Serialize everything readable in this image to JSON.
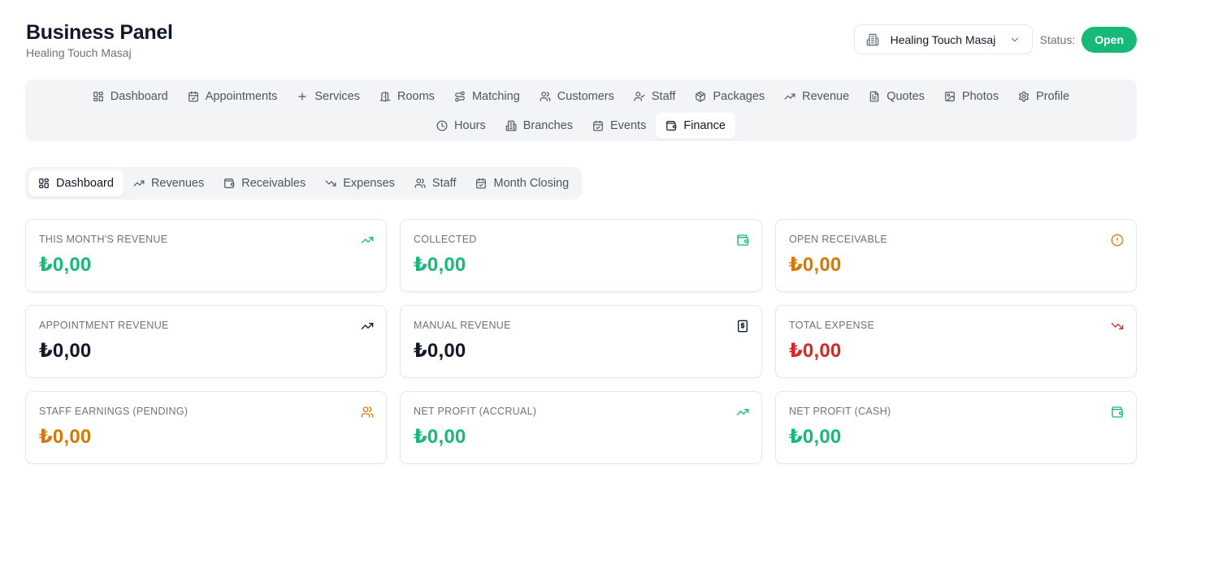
{
  "header": {
    "title": "Business Panel",
    "subtitle": "Healing Touch Masaj",
    "business_select": {
      "value": "Healing Touch Masaj",
      "icon": "building-icon"
    },
    "status_label": "Status:",
    "status_value": "Open",
    "status_color": "#16b978"
  },
  "main_nav": {
    "row1": [
      {
        "label": "Dashboard",
        "icon": "layout-grid-icon"
      },
      {
        "label": "Appointments",
        "icon": "calendar-check-icon"
      },
      {
        "label": "Services",
        "icon": "plus-icon"
      },
      {
        "label": "Rooms",
        "icon": "door-icon"
      },
      {
        "label": "Matching",
        "icon": "route-icon"
      },
      {
        "label": "Customers",
        "icon": "users-icon"
      },
      {
        "label": "Staff",
        "icon": "user-check-icon"
      },
      {
        "label": "Packages",
        "icon": "package-icon"
      },
      {
        "label": "Revenue",
        "icon": "trending-up-icon"
      },
      {
        "label": "Quotes",
        "icon": "file-text-icon"
      },
      {
        "label": "Photos",
        "icon": "image-icon"
      },
      {
        "label": "Profile",
        "icon": "gear-icon"
      }
    ],
    "row2": [
      {
        "label": "Hours",
        "icon": "clock-icon"
      },
      {
        "label": "Branches",
        "icon": "building-icon"
      },
      {
        "label": "Events",
        "icon": "calendar-check-icon"
      },
      {
        "label": "Finance",
        "icon": "wallet-icon",
        "active": true
      }
    ]
  },
  "finance_tabs": [
    {
      "label": "Dashboard",
      "icon": "layout-grid-icon",
      "active": true
    },
    {
      "label": "Revenues",
      "icon": "trending-up-icon"
    },
    {
      "label": "Receivables",
      "icon": "wallet-icon"
    },
    {
      "label": "Expenses",
      "icon": "trending-down-icon"
    },
    {
      "label": "Staff",
      "icon": "users-icon"
    },
    {
      "label": "Month Closing",
      "icon": "calendar-check-icon"
    }
  ],
  "cards": [
    {
      "label": "THIS MONTH'S REVENUE",
      "value": "₺0,00",
      "color": "#16b978",
      "icon": "trending-up-icon",
      "icon_color": "#16b978"
    },
    {
      "label": "COLLECTED",
      "value": "₺0,00",
      "color": "#16b978",
      "icon": "wallet-icon",
      "icon_color": "#16b978"
    },
    {
      "label": "OPEN RECEIVABLE",
      "value": "₺0,00",
      "color": "#d97706",
      "icon": "alert-circle-icon",
      "icon_color": "#d97706"
    },
    {
      "label": "APPOINTMENT REVENUE",
      "value": "₺0,00",
      "color": "#111827",
      "icon": "trending-up-icon",
      "icon_color": "#111827"
    },
    {
      "label": "MANUAL REVENUE",
      "value": "₺0,00",
      "color": "#111827",
      "icon": "receipt-icon",
      "icon_color": "#111827"
    },
    {
      "label": "TOTAL EXPENSE",
      "value": "₺0,00",
      "color": "#dc2626",
      "icon": "trending-down-icon",
      "icon_color": "#dc2626"
    },
    {
      "label": "STAFF EARNINGS (PENDING)",
      "value": "₺0,00",
      "color": "#d97706",
      "icon": "users-icon",
      "icon_color": "#d97706"
    },
    {
      "label": "NET PROFIT (ACCRUAL)",
      "value": "₺0,00",
      "color": "#16b978",
      "icon": "trending-up-icon",
      "icon_color": "#16b978"
    },
    {
      "label": "NET PROFIT (CASH)",
      "value": "₺0,00",
      "color": "#16b978",
      "icon": "wallet-icon",
      "icon_color": "#16b978"
    }
  ]
}
